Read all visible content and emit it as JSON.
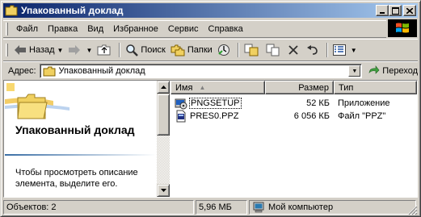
{
  "window": {
    "title": "Упакованный доклад",
    "icons": {
      "app": "folder-icon",
      "minimize": "minimize-icon",
      "maximize": "maximize-icon",
      "close": "close-icon"
    }
  },
  "menubar": {
    "items": [
      "Файл",
      "Правка",
      "Вид",
      "Избранное",
      "Сервис",
      "Справка"
    ]
  },
  "toolbar": {
    "back_label": "Назад",
    "search_label": "Поиск",
    "folders_label": "Папки"
  },
  "addressbar": {
    "label": "Адрес:",
    "value": "Упакованный доклад",
    "go_label": "Переход"
  },
  "leftpane": {
    "title": "Упакованный доклад",
    "description": "Чтобы просмотреть описание элемента, выделите его."
  },
  "filelist": {
    "columns": [
      "Имя",
      "Размер",
      "Тип"
    ],
    "rows": [
      {
        "name": "PNGSETUP",
        "size": "52 КБ",
        "type": "Приложение",
        "icon": "setup-app-icon"
      },
      {
        "name": "PRES0.PPZ",
        "size": "6 056 КБ",
        "type": "Файл \"PPZ\"",
        "icon": "ppz-file-icon"
      }
    ]
  },
  "statusbar": {
    "objects": "Объектов: 2",
    "size": "5,96 МБ",
    "location": "Мой компьютер"
  },
  "colors": {
    "titlebar_start": "#0a246a",
    "titlebar_end": "#a6caf0",
    "face": "#d4d0c8"
  }
}
